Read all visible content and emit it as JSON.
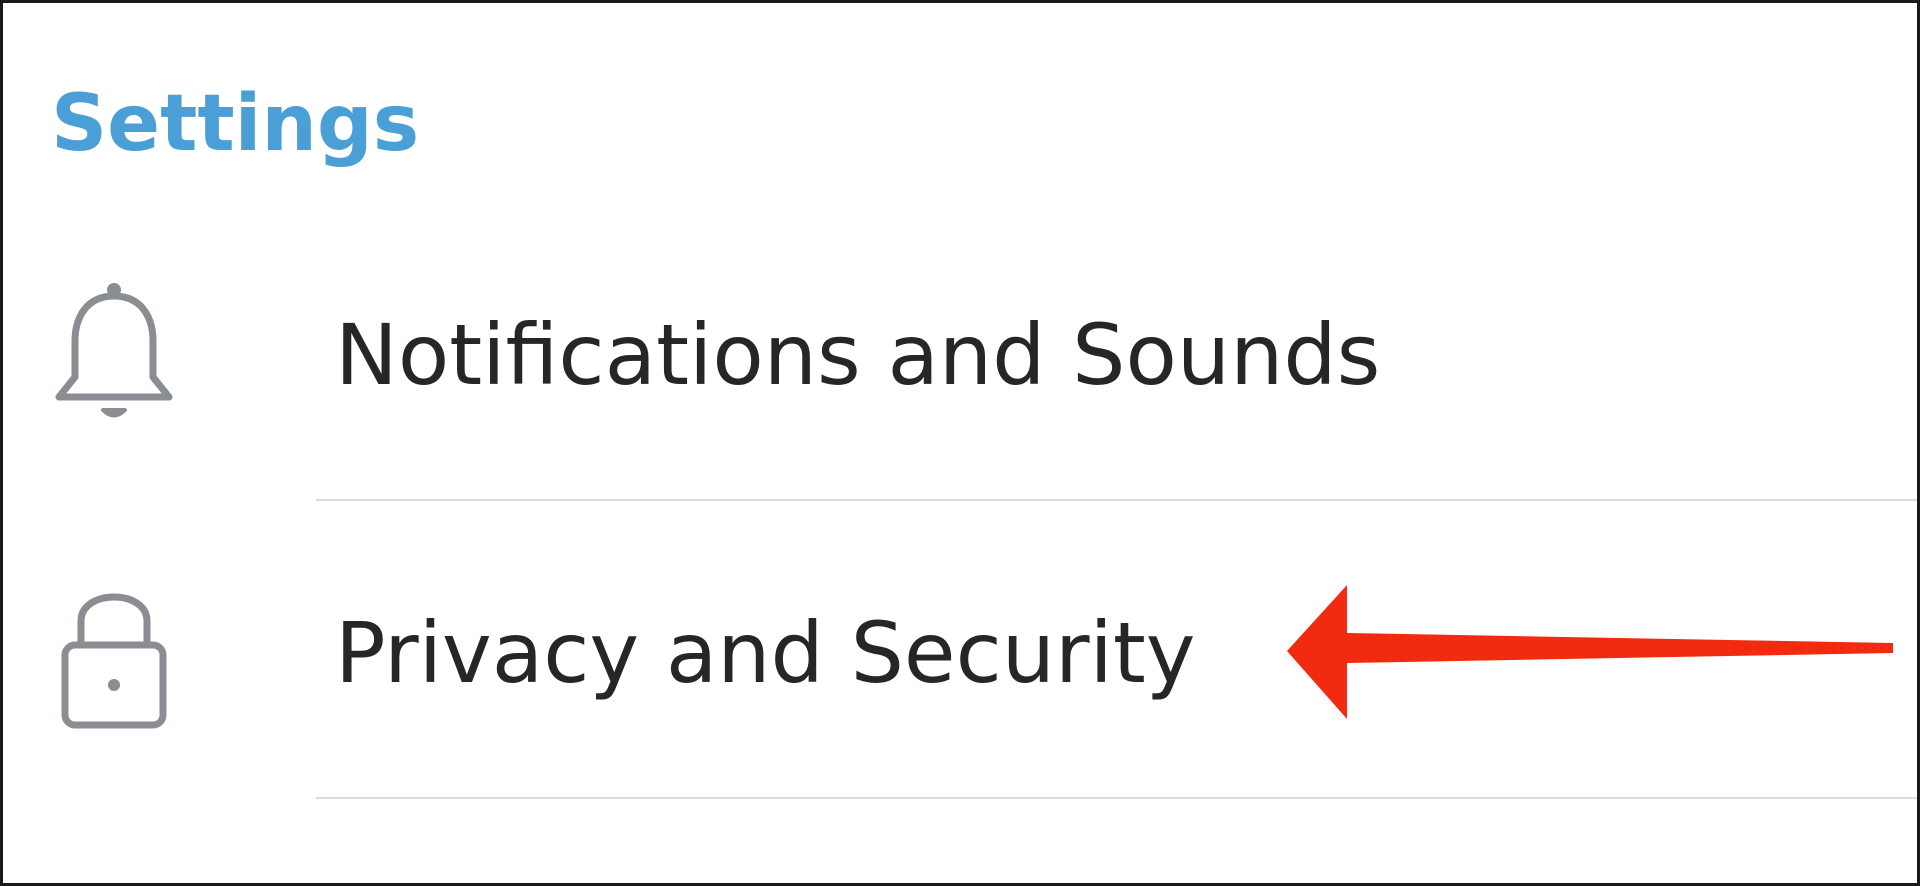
{
  "header": {
    "title": "Settings"
  },
  "items": [
    {
      "label": "Notifications and Sounds",
      "icon": "bell-icon"
    },
    {
      "label": "Privacy and Security",
      "icon": "lock-icon"
    }
  ],
  "colors": {
    "accent": "#4a9fd6",
    "text": "#262626",
    "icon": "#8a8d91",
    "divider": "#dcdcdc",
    "arrow": "#f22b10"
  }
}
